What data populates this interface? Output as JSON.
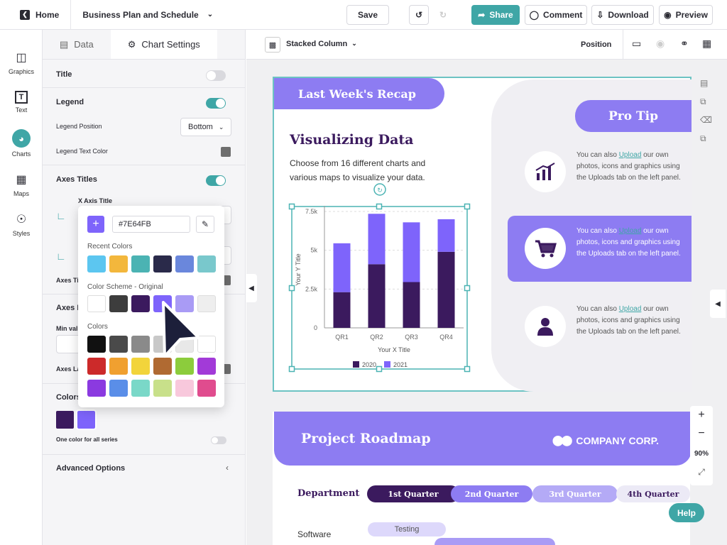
{
  "topbar": {
    "home": "Home",
    "doc_title": "Business Plan and Schedule",
    "save": "Save",
    "share": "Share",
    "comment": "Comment",
    "download": "Download",
    "preview": "Preview"
  },
  "rail": [
    {
      "label": "Graphics",
      "icon": "graphics-icon"
    },
    {
      "label": "Text",
      "icon": "text-icon"
    },
    {
      "label": "Charts",
      "icon": "charts-icon"
    },
    {
      "label": "Maps",
      "icon": "maps-icon"
    },
    {
      "label": "Styles",
      "icon": "styles-icon"
    }
  ],
  "panel": {
    "tabs": [
      "Data",
      "Chart Settings"
    ],
    "title": "Title",
    "legend": "Legend",
    "legend_position": "Legend Position",
    "legend_position_value": "Bottom",
    "legend_text_color": "Legend Text Color",
    "axes_titles": "Axes Titles",
    "x_axis_title": "X Axis Title",
    "axes_ti": "Axes Ti",
    "axes_l": "Axes L",
    "min_val": "Min val",
    "axes_la": "Axes La",
    "colors": "Colors",
    "one_color": "One color for all series",
    "advanced": "Advanced Options"
  },
  "picker": {
    "hex": "#7E64FB",
    "recent_title": "Recent Colors",
    "recent": [
      "#5cc6f0",
      "#f3b73c",
      "#4bb3b3",
      "#2a2a4a",
      "#6a87dc",
      "#79c8cc"
    ],
    "scheme_title": "Color Scheme - Original",
    "scheme": [
      "#ffffff",
      "#3d3d3d",
      "#3b1a5e",
      "#7e64fb",
      "#a99bf5",
      "#eeeeee"
    ],
    "colors_title": "Colors",
    "colors": [
      "#111111",
      "#4a4a4a",
      "#8a8a8a",
      "#c8c8c8",
      "#e8e8e8",
      "#ffffff",
      "#cc2a2a",
      "#f0a030",
      "#f2d43b",
      "#b06a32",
      "#8ccc3c",
      "#a23ad8",
      "#8b3ae0",
      "#5a8ee8",
      "#7ad8c8",
      "#c8e08a",
      "#f8c8dc",
      "#e04c8e"
    ]
  },
  "canvas_toolbar": {
    "chart_type": "Stacked Column",
    "position": "Position"
  },
  "slide": {
    "recap": "Last Week's Recap",
    "heading": "Visualizing Data",
    "body": "Choose from 16 different charts and various maps to visualize your data.",
    "pro_tip": "Pro Tip",
    "tips": [
      {
        "pre": "You can also ",
        "link": "Upload",
        "post": " our own photos, icons and graphics using the Uploads tab on the left panel.",
        "icon": "bar-chart-icon"
      },
      {
        "pre": "You can also ",
        "link": "Upload",
        "post": " our own photos, icons and graphics using the Uploads tab on the left panel.",
        "icon": "cart-icon"
      },
      {
        "pre": "You can also ",
        "link": "Upload",
        "post": " our own photos, icons and graphics using the Uploads tab on the left panel.",
        "icon": "person-icon"
      }
    ]
  },
  "chart_data": {
    "type": "bar",
    "categories": [
      "QR1",
      "QR2",
      "QR3",
      "QR4"
    ],
    "series": [
      {
        "name": "2020",
        "values": [
          2300,
          4100,
          2950,
          4900
        ],
        "color": "#3b1a5e"
      },
      {
        "name": "2021",
        "values": [
          3150,
          3250,
          3850,
          2100
        ],
        "color": "#7e64fb"
      }
    ],
    "yticks": [
      "0",
      "2.5k",
      "5k",
      "7.5k"
    ],
    "ylim": [
      0,
      7500
    ],
    "xlabel": "Your X Title",
    "ylabel": "Your Y Title",
    "legend": "bottom"
  },
  "slide2": {
    "title": "Project Roadmap",
    "company": "COMPANY CORP.",
    "department": "Department",
    "quarters": [
      "1st Quarter",
      "2nd Quarter",
      "3rd Quarter",
      "4th Quarter"
    ],
    "software": "Software",
    "testing": "Testing"
  },
  "zoom": {
    "plus": "+",
    "minus": "−",
    "level": "90%"
  },
  "help": "Help"
}
